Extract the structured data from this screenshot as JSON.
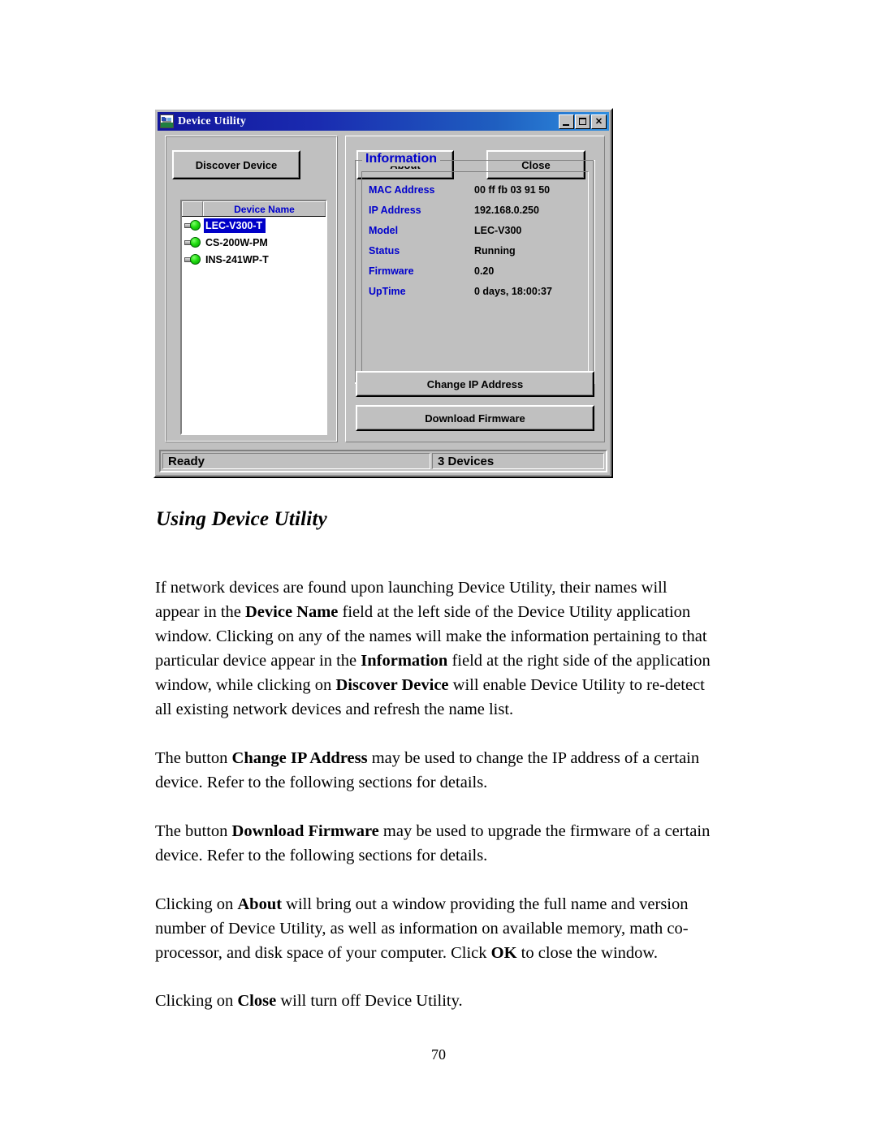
{
  "document": {
    "heading": "Using Device Utility",
    "page_number": "70",
    "paragraphs": {
      "p1_a": "If network devices are found upon launching Device Utility, their names will appear in the ",
      "p1_b": "Device Name",
      "p1_c": " field at the left side of the Device Utility application window. Clicking on any of the names will make the information pertaining to that particular device appear in the ",
      "p1_d": "Information",
      "p1_e": " field at the right side of the application window, while clicking on ",
      "p1_f": "Discover Device",
      "p1_g": " will enable Device Utility to re-detect all existing network devices and refresh the name list.",
      "p2_a": "The button ",
      "p2_b": "Change IP Address",
      "p2_c": " may be used to change the IP address of a certain device. Refer to the following sections for details.",
      "p3_a": "The button ",
      "p3_b": "Download Firmware",
      "p3_c": " may be used to upgrade the firmware of a certain device. Refer to the following sections for details.",
      "p4_a": "Clicking on ",
      "p4_b": "About",
      "p4_c": " will bring out a window providing the full name and version number of Device Utility, as well as information on available memory, math co-processor, and disk space of your computer. Click ",
      "p4_d": "OK",
      "p4_e": " to close the window.",
      "p5_a": "Clicking on ",
      "p5_b": "Close",
      "p5_c": " will turn off Device Utility."
    }
  },
  "app_window": {
    "title": "Device Utility",
    "title_icon": "device-utility-icon",
    "window_controls": {
      "minimize": "minimize-icon",
      "maximize": "maximize-icon",
      "close": "close-icon"
    },
    "toolbar": {
      "discover_device": "Discover Device",
      "about": "About",
      "close": "Close"
    },
    "device_list": {
      "columns": [
        "",
        "Device Name"
      ],
      "rows": [
        {
          "icon": "green-plug-icon",
          "name": "LEC-V300-T",
          "selected": true
        },
        {
          "icon": "green-plug-icon",
          "name": "CS-200W-PM",
          "selected": false
        },
        {
          "icon": "green-plug-icon",
          "name": "INS-241WP-T",
          "selected": false
        }
      ]
    },
    "information": {
      "legend": "Information",
      "fields": [
        {
          "label": "MAC Address",
          "value": "00 ff fb 03 91 50"
        },
        {
          "label": "IP Address",
          "value": "192.168.0.250"
        },
        {
          "label": "Model",
          "value": "LEC-V300"
        },
        {
          "label": "Status",
          "value": "Running"
        },
        {
          "label": "Firmware",
          "value": "0.20"
        },
        {
          "label": "UpTime",
          "value": "0 days, 18:00:37"
        }
      ],
      "change_ip_button": "Change IP Address",
      "download_firmware_button": "Download Firmware"
    },
    "statusbar": {
      "left": "Ready",
      "right": "3 Devices"
    },
    "colors": {
      "titlebar_start": "#12169c",
      "titlebar_end": "#2f8fe0",
      "face": "#c0c0c0",
      "label_blue": "#0000cc",
      "selection_blue": "#0000c8",
      "led_green": "#22dd11"
    }
  }
}
